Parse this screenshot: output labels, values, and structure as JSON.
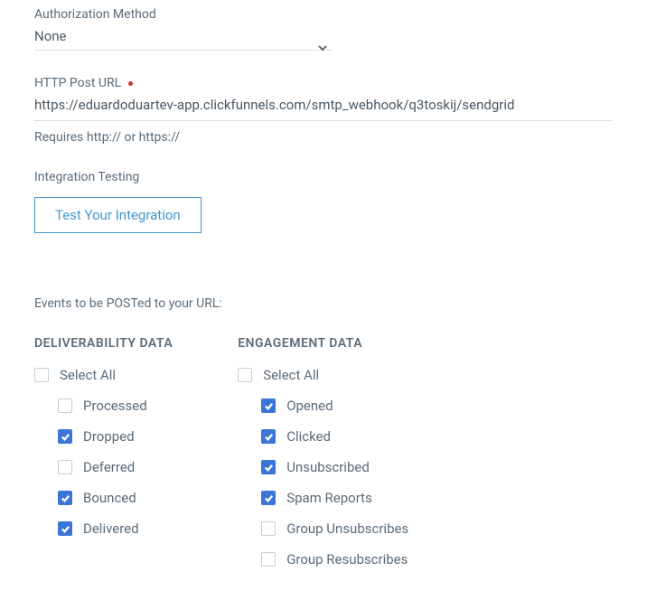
{
  "auth": {
    "label": "Authorization Method",
    "value": "None"
  },
  "postUrl": {
    "label": "HTTP Post URL",
    "value": "https://eduardoduartev-app.clickfunnels.com/smtp_webhook/q3toskij/sendgrid",
    "helper": "Requires http:// or https://"
  },
  "integration": {
    "label": "Integration Testing",
    "button": "Test Your Integration"
  },
  "events": {
    "title": "Events to be POSTed to your URL:",
    "deliverability": {
      "header": "DELIVERABILITY DATA",
      "selectAll": {
        "label": "Select All",
        "checked": false
      },
      "items": [
        {
          "label": "Processed",
          "checked": false
        },
        {
          "label": "Dropped",
          "checked": true
        },
        {
          "label": "Deferred",
          "checked": false
        },
        {
          "label": "Bounced",
          "checked": true
        },
        {
          "label": "Delivered",
          "checked": true
        }
      ]
    },
    "engagement": {
      "header": "ENGAGEMENT DATA",
      "selectAll": {
        "label": "Select All",
        "checked": false
      },
      "items": [
        {
          "label": "Opened",
          "checked": true
        },
        {
          "label": "Clicked",
          "checked": true
        },
        {
          "label": "Unsubscribed",
          "checked": true
        },
        {
          "label": "Spam Reports",
          "checked": true
        },
        {
          "label": "Group Unsubscribes",
          "checked": false
        },
        {
          "label": "Group Resubscribes",
          "checked": false
        }
      ]
    }
  }
}
